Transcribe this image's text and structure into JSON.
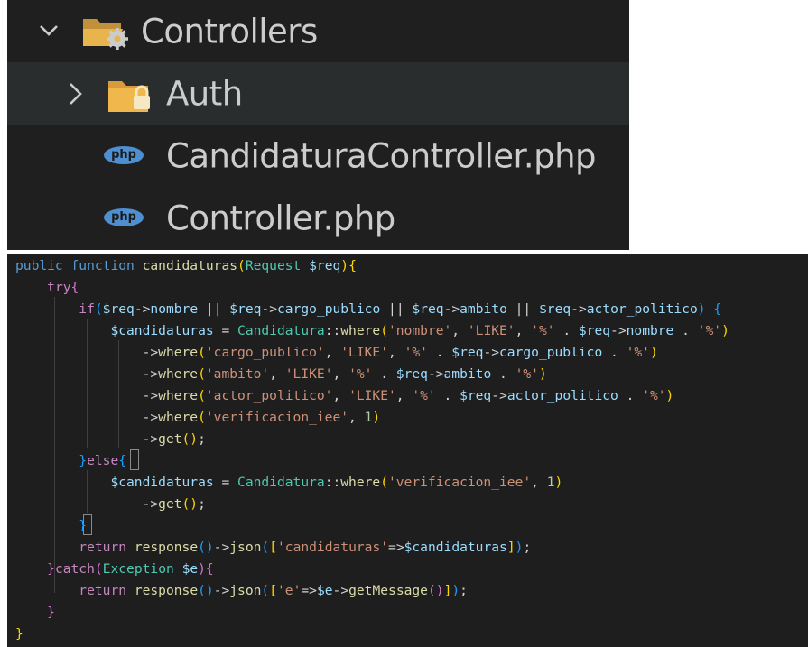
{
  "explorer": {
    "items": [
      {
        "label": "Controllers",
        "icon": "folder-open-gear-icon"
      },
      {
        "label": "Auth",
        "icon": "folder-lock-icon"
      },
      {
        "label": "CandidaturaController.php",
        "icon": "php-file-icon"
      },
      {
        "label": "Controller.php",
        "icon": "php-file-icon"
      }
    ],
    "php_icon_text": "php"
  },
  "colors": {
    "keyword": "#569cd6",
    "control": "#c586c0",
    "function": "#dcdcaa",
    "type": "#4ec9b0",
    "variable": "#9cdcfe",
    "string": "#ce9178",
    "number": "#b5cea8",
    "bracket1": "#ffd700",
    "bracket2": "#da70d6",
    "bracket3": "#179fff"
  },
  "code": {
    "lines": [
      [
        [
          "kw",
          "public "
        ],
        [
          "kw",
          "function "
        ],
        [
          "fn",
          "candidaturas"
        ],
        [
          "b1",
          "("
        ],
        [
          "ty",
          "Request "
        ],
        [
          "vr",
          "$req"
        ],
        [
          "b1",
          "){"
        ]
      ],
      [
        [
          "op",
          "    "
        ],
        [
          "ctl",
          "try"
        ],
        [
          "b2",
          "{"
        ]
      ],
      [
        [
          "op",
          "        "
        ],
        [
          "ctl",
          "if"
        ],
        [
          "b3",
          "("
        ],
        [
          "vr",
          "$req"
        ],
        [
          "op",
          "->"
        ],
        [
          "vr",
          "nombre"
        ],
        [
          "op",
          " || "
        ],
        [
          "vr",
          "$req"
        ],
        [
          "op",
          "->"
        ],
        [
          "vr",
          "cargo_publico"
        ],
        [
          "op",
          " || "
        ],
        [
          "vr",
          "$req"
        ],
        [
          "op",
          "->"
        ],
        [
          "vr",
          "ambito"
        ],
        [
          "op",
          " || "
        ],
        [
          "vr",
          "$req"
        ],
        [
          "op",
          "->"
        ],
        [
          "vr",
          "actor_politico"
        ],
        [
          "b3",
          ")"
        ],
        [
          "op",
          " "
        ],
        [
          "b3",
          "{"
        ]
      ],
      [
        [
          "op",
          "            "
        ],
        [
          "vr",
          "$candidaturas"
        ],
        [
          "op",
          " = "
        ],
        [
          "ty",
          "Candidatura"
        ],
        [
          "op",
          "::"
        ],
        [
          "fn",
          "where"
        ],
        [
          "b1",
          "("
        ],
        [
          "st",
          "'nombre'"
        ],
        [
          "op",
          ", "
        ],
        [
          "st",
          "'LIKE'"
        ],
        [
          "op",
          ", "
        ],
        [
          "st",
          "'%'"
        ],
        [
          "op",
          " . "
        ],
        [
          "vr",
          "$req"
        ],
        [
          "op",
          "->"
        ],
        [
          "vr",
          "nombre"
        ],
        [
          "op",
          " . "
        ],
        [
          "st",
          "'%'"
        ],
        [
          "b1",
          ")"
        ]
      ],
      [
        [
          "op",
          "                ->"
        ],
        [
          "fn",
          "where"
        ],
        [
          "b1",
          "("
        ],
        [
          "st",
          "'cargo_publico'"
        ],
        [
          "op",
          ", "
        ],
        [
          "st",
          "'LIKE'"
        ],
        [
          "op",
          ", "
        ],
        [
          "st",
          "'%'"
        ],
        [
          "op",
          " . "
        ],
        [
          "vr",
          "$req"
        ],
        [
          "op",
          "->"
        ],
        [
          "vr",
          "cargo_publico"
        ],
        [
          "op",
          " . "
        ],
        [
          "st",
          "'%'"
        ],
        [
          "b1",
          ")"
        ]
      ],
      [
        [
          "op",
          "                ->"
        ],
        [
          "fn",
          "where"
        ],
        [
          "b1",
          "("
        ],
        [
          "st",
          "'ambito'"
        ],
        [
          "op",
          ", "
        ],
        [
          "st",
          "'LIKE'"
        ],
        [
          "op",
          ", "
        ],
        [
          "st",
          "'%'"
        ],
        [
          "op",
          " . "
        ],
        [
          "vr",
          "$req"
        ],
        [
          "op",
          "->"
        ],
        [
          "vr",
          "ambito"
        ],
        [
          "op",
          " . "
        ],
        [
          "st",
          "'%'"
        ],
        [
          "b1",
          ")"
        ]
      ],
      [
        [
          "op",
          "                ->"
        ],
        [
          "fn",
          "where"
        ],
        [
          "b1",
          "("
        ],
        [
          "st",
          "'actor_politico'"
        ],
        [
          "op",
          ", "
        ],
        [
          "st",
          "'LIKE'"
        ],
        [
          "op",
          ", "
        ],
        [
          "st",
          "'%'"
        ],
        [
          "op",
          " . "
        ],
        [
          "vr",
          "$req"
        ],
        [
          "op",
          "->"
        ],
        [
          "vr",
          "actor_politico"
        ],
        [
          "op",
          " . "
        ],
        [
          "st",
          "'%'"
        ],
        [
          "b1",
          ")"
        ]
      ],
      [
        [
          "op",
          "                ->"
        ],
        [
          "fn",
          "where"
        ],
        [
          "b1",
          "("
        ],
        [
          "st",
          "'verificacion_iee'"
        ],
        [
          "op",
          ", "
        ],
        [
          "nm",
          "1"
        ],
        [
          "b1",
          ")"
        ]
      ],
      [
        [
          "op",
          "                ->"
        ],
        [
          "fn",
          "get"
        ],
        [
          "b1",
          "()"
        ],
        [
          "op",
          ";"
        ]
      ],
      [
        [
          "op",
          "        "
        ],
        [
          "b3",
          "}"
        ],
        [
          "ctl",
          "else"
        ],
        [
          "b3",
          "{"
        ]
      ],
      [
        [
          "op",
          "            "
        ],
        [
          "vr",
          "$candidaturas"
        ],
        [
          "op",
          " = "
        ],
        [
          "ty",
          "Candidatura"
        ],
        [
          "op",
          "::"
        ],
        [
          "fn",
          "where"
        ],
        [
          "b1",
          "("
        ],
        [
          "st",
          "'verificacion_iee'"
        ],
        [
          "op",
          ", "
        ],
        [
          "nm",
          "1"
        ],
        [
          "b1",
          ")"
        ]
      ],
      [
        [
          "op",
          "                ->"
        ],
        [
          "fn",
          "get"
        ],
        [
          "b1",
          "()"
        ],
        [
          "op",
          ";"
        ]
      ],
      [
        [
          "op",
          "        "
        ],
        [
          "b3",
          "}"
        ]
      ],
      [
        [
          "op",
          "        "
        ],
        [
          "ctl",
          "return "
        ],
        [
          "fn",
          "response"
        ],
        [
          "b3",
          "()"
        ],
        [
          "op",
          "->"
        ],
        [
          "fn",
          "json"
        ],
        [
          "b3",
          "("
        ],
        [
          "b1",
          "["
        ],
        [
          "st",
          "'candidaturas'"
        ],
        [
          "op",
          "=>"
        ],
        [
          "vr",
          "$candidaturas"
        ],
        [
          "b1",
          "]"
        ],
        [
          "b3",
          ")"
        ],
        [
          "op",
          ";"
        ]
      ],
      [
        [
          "op",
          "    "
        ],
        [
          "b2",
          "}"
        ],
        [
          "ctl",
          "catch"
        ],
        [
          "b2",
          "("
        ],
        [
          "ty",
          "Exception "
        ],
        [
          "vr",
          "$e"
        ],
        [
          "b2",
          "){"
        ]
      ],
      [
        [
          "op",
          "        "
        ],
        [
          "ctl",
          "return "
        ],
        [
          "fn",
          "response"
        ],
        [
          "b3",
          "()"
        ],
        [
          "op",
          "->"
        ],
        [
          "fn",
          "json"
        ],
        [
          "b3",
          "("
        ],
        [
          "b1",
          "["
        ],
        [
          "st",
          "'e'"
        ],
        [
          "op",
          "=>"
        ],
        [
          "vr",
          "$e"
        ],
        [
          "op",
          "->"
        ],
        [
          "fn",
          "getMessage"
        ],
        [
          "b2",
          "()"
        ],
        [
          "b1",
          "]"
        ],
        [
          "b3",
          ")"
        ],
        [
          "op",
          ";"
        ]
      ],
      [
        [
          "op",
          "    "
        ],
        [
          "b2",
          "}"
        ]
      ],
      [
        [
          "b1",
          "}"
        ]
      ]
    ]
  }
}
